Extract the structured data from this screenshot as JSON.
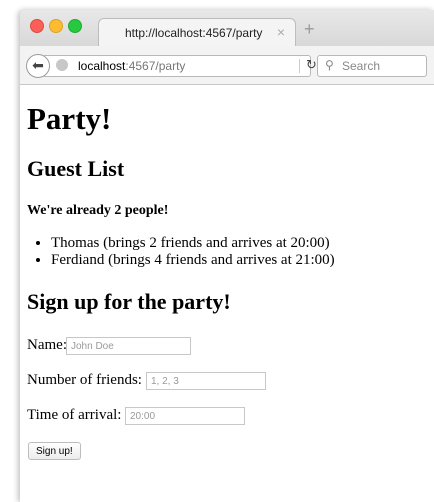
{
  "browser": {
    "tab_title": "http://localhost:4567/party",
    "tab_close": "×",
    "new_tab": "+",
    "url_host": "localhost",
    "url_rest": ":4567/party",
    "search_placeholder": "Search",
    "back_icon": "arrow-left",
    "reload_icon": "reload",
    "search_icon": "magnifier",
    "traffic_colors": [
      "#fc5f57",
      "#fdbb2f",
      "#27c93f"
    ]
  },
  "page": {
    "title": "Party!",
    "guest_list_heading": "Guest List",
    "guest_count_text": "We're already 2 people!",
    "guests": [
      "Thomas (brings 2 friends and arrives at 20:00)",
      "Ferdiand (brings 4 friends and arrives at 21:00)"
    ],
    "signup_heading": "Sign up for the party!",
    "form": {
      "name_label": "Name:",
      "name_placeholder": "John Doe",
      "friends_label": "Number of friends:",
      "friends_placeholder": "1, 2, 3",
      "arrival_label": "Time of arrival:",
      "arrival_placeholder": "20:00",
      "submit_label": "Sign up!"
    }
  }
}
